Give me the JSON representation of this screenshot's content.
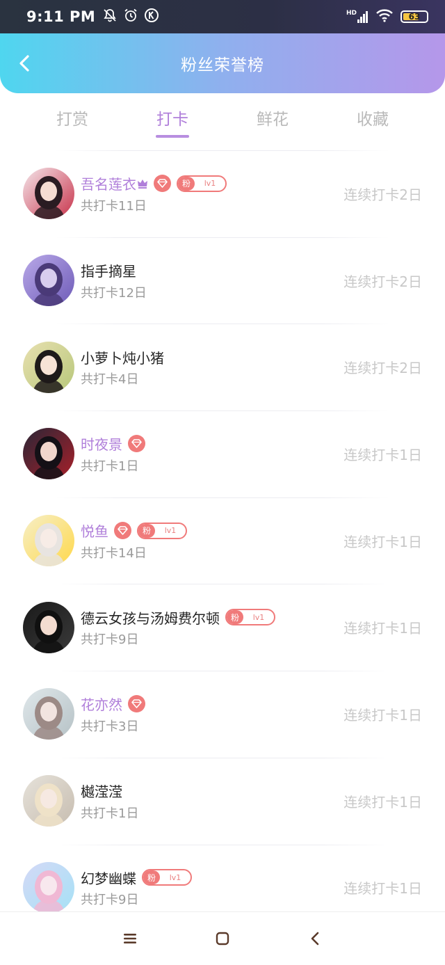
{
  "status_bar": {
    "time": "9:11 PM",
    "icons": [
      "bell-off-icon",
      "alarm-icon",
      "k-badge-icon",
      "signal-icon",
      "wifi-icon",
      "battery-icon"
    ],
    "signal_label": "HD",
    "battery_level": "63"
  },
  "header": {
    "title": "粉丝荣誉榜",
    "back_icon": "chevron-left-icon"
  },
  "tabs": [
    {
      "label": "打赏",
      "active": false
    },
    {
      "label": "打卡",
      "active": true
    },
    {
      "label": "鲜花",
      "active": false
    },
    {
      "label": "收藏",
      "active": false
    }
  ],
  "colors": {
    "accent": "#b07fda",
    "badge_red": "#f07a7a",
    "header_start": "#4fd6ef",
    "header_end": "#b597ea"
  },
  "fan_badge": {
    "fan_label": "粉",
    "level_label": "lv1"
  },
  "rows": [
    {
      "name": "吾名莲衣",
      "total": "共打卡11日",
      "streak": "连续打卡2日",
      "vip": true,
      "crown": true,
      "diamond": true,
      "fan": true
    },
    {
      "name": "指手摘星",
      "total": "共打卡12日",
      "streak": "连续打卡2日",
      "vip": false,
      "crown": false,
      "diamond": false,
      "fan": false
    },
    {
      "name": "小萝卜炖小猪",
      "total": "共打卡4日",
      "streak": "连续打卡2日",
      "vip": false,
      "crown": false,
      "diamond": false,
      "fan": false
    },
    {
      "name": "时夜景",
      "total": "共打卡1日",
      "streak": "连续打卡1日",
      "vip": true,
      "crown": false,
      "diamond": true,
      "fan": false
    },
    {
      "name": "悦鱼",
      "total": "共打卡14日",
      "streak": "连续打卡1日",
      "vip": true,
      "crown": false,
      "diamond": true,
      "fan": true
    },
    {
      "name": "德云女孩与汤姆费尔顿",
      "total": "共打卡9日",
      "streak": "连续打卡1日",
      "vip": false,
      "crown": false,
      "diamond": false,
      "fan": true
    },
    {
      "name": "花亦然",
      "total": "共打卡3日",
      "streak": "连续打卡1日",
      "vip": true,
      "crown": false,
      "diamond": true,
      "fan": false
    },
    {
      "name": "樾滢滢",
      "total": "共打卡1日",
      "streak": "连续打卡1日",
      "vip": false,
      "crown": false,
      "diamond": false,
      "fan": false
    },
    {
      "name": "幻梦幽蝶",
      "total": "共打卡9日",
      "streak": "连续打卡1日",
      "vip": false,
      "crown": false,
      "diamond": false,
      "fan": true
    }
  ],
  "nav_bar": {
    "icons": [
      "menu-icon",
      "home-square-icon",
      "back-triangle-icon"
    ]
  }
}
